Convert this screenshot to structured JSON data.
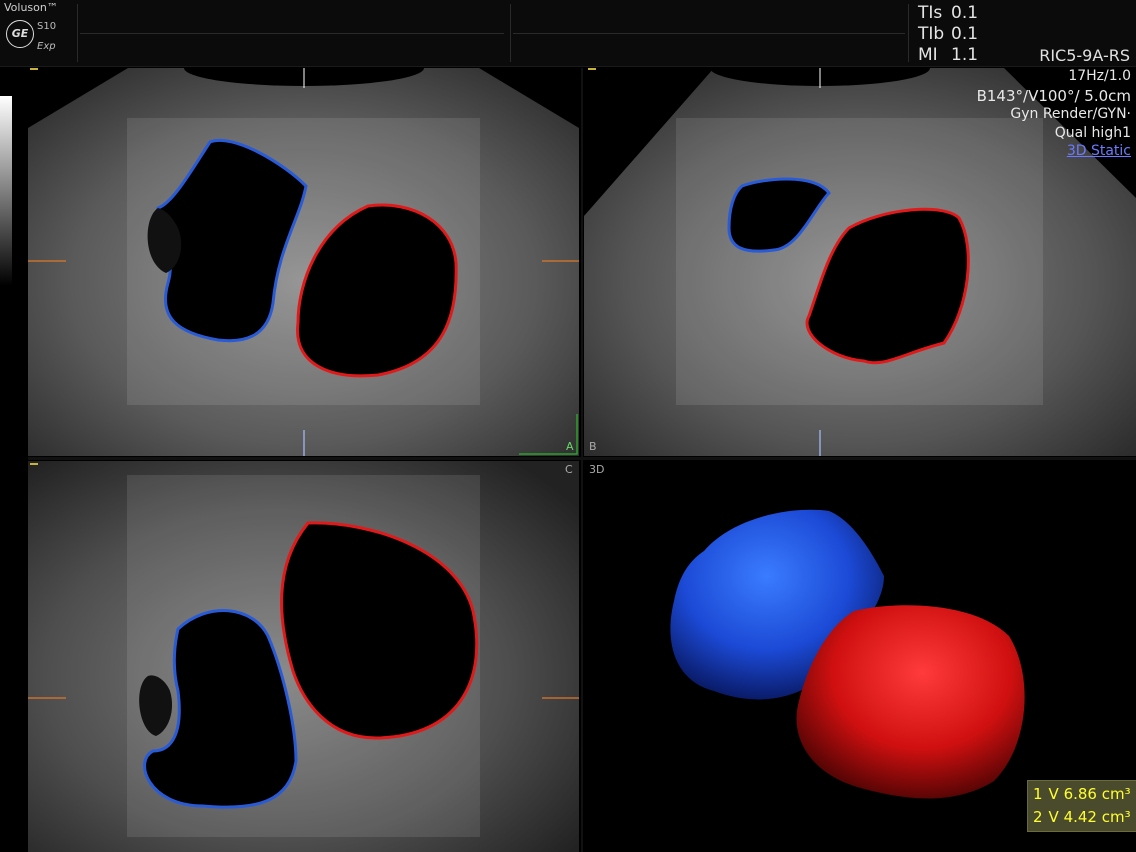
{
  "header": {
    "brand": "Voluson™",
    "logo_text": "GE",
    "model": "S10",
    "mode": "Exp",
    "safety": [
      {
        "label": "TIs",
        "value": "0.1"
      },
      {
        "label": "TIb",
        "value": "0.1"
      },
      {
        "label": "MI",
        "value": "1.1"
      }
    ],
    "probe": "RIC5-9A-RS"
  },
  "info": {
    "frame_rate": "17Hz/1.0",
    "angles": "B143°/V100°/ 5.0cm",
    "preset": "Gyn Render/GYN·",
    "quality": "Qual high1",
    "mode": "3D Static"
  },
  "panels": {
    "a": {
      "label": "A"
    },
    "b": {
      "label": "B"
    },
    "c": {
      "label": "C"
    },
    "d": {
      "label": "3D"
    }
  },
  "volumes": [
    {
      "index": "1",
      "text": "V 6.86 cm³"
    },
    {
      "index": "2",
      "text": "V 4.42 cm³"
    }
  ],
  "colors": {
    "outline_1": "#2a5bd7",
    "outline_2": "#e01a1a",
    "mode_text": "#6b7bff",
    "volume_text": "#ffff30"
  }
}
